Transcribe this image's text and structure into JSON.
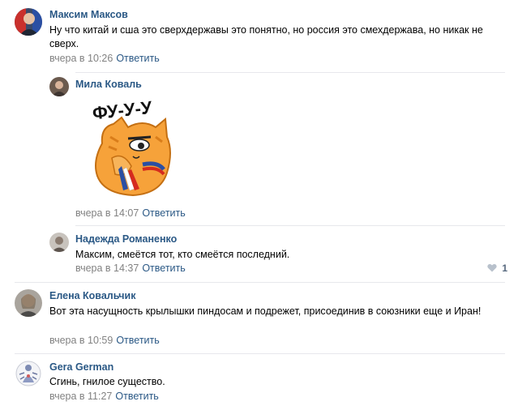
{
  "comments": [
    {
      "author": "Максим Максов",
      "text": "Ну что китай и сша это сверхдержавы это понятно, но россия это смехдержава, но никак не сверх.",
      "time": "вчера в 10:26",
      "reply": "Ответить"
    },
    {
      "author": "Мила Коваль",
      "sticker_text": "ФУ-У-У",
      "time": "вчера в 14:07",
      "reply": "Ответить"
    },
    {
      "author": "Надежда Романенко",
      "text": "Максим, смеётся тот, кто смеётся последний.",
      "time": "вчера в 14:37",
      "reply": "Ответить",
      "likes": "1"
    },
    {
      "author": "Елена Ковальчик",
      "text": "Вот эта насущность крылышки пиндосам и подрежет, присоединив в союзники еще и Иран!",
      "time": "вчера в 10:59",
      "reply": "Ответить"
    },
    {
      "author": "Gera German",
      "text": "Сгинь, гнилое существо.",
      "time": "вчера в 11:27",
      "reply": "Ответить"
    }
  ],
  "icons": {
    "like": "heart-icon"
  },
  "colors": {
    "link": "#2a5885",
    "muted": "#828282",
    "divider": "#e7e8ec"
  }
}
